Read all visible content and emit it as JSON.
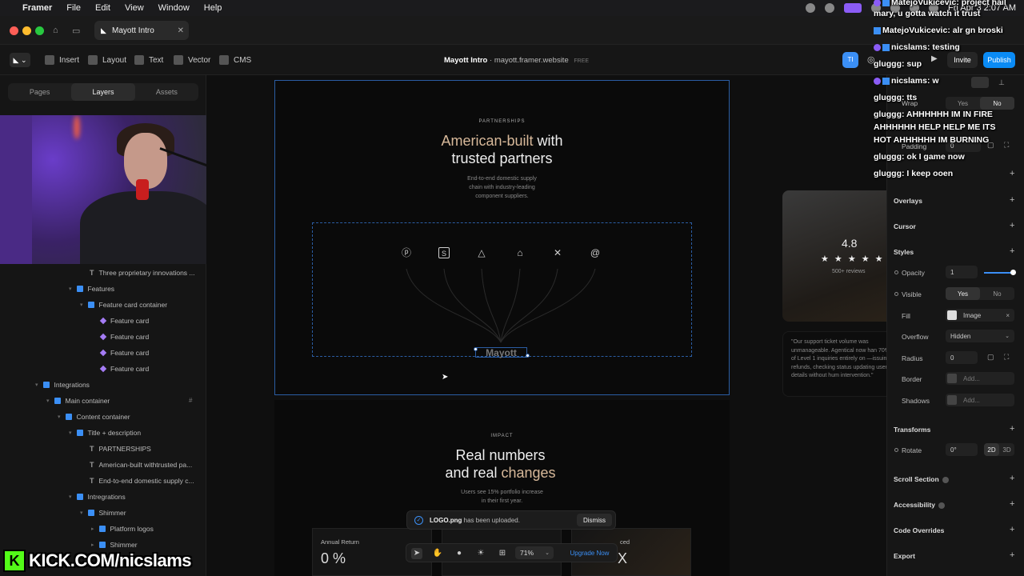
{
  "menubar": {
    "app": "Framer",
    "items": [
      "File",
      "Edit",
      "View",
      "Window",
      "Help"
    ],
    "clock": "Fri Apr 3  2:07 AM"
  },
  "titlebar": {
    "tab_title": "Mayott Intro"
  },
  "toolbar": {
    "tools": [
      "Insert",
      "Layout",
      "Text",
      "Vector",
      "CMS"
    ],
    "site_name": "Mayott Intro",
    "site_url": "mayott.framer.website",
    "plan": "FREE",
    "avatar_initials": "TI",
    "invite_label": "Invite",
    "publish_label": "Publish"
  },
  "left_panel": {
    "tabs": [
      "Pages",
      "Layers",
      "Assets"
    ],
    "active_tab": "Layers",
    "layers": [
      {
        "type": "text",
        "label": "Three proprietary innovations ..."
      },
      {
        "type": "frame",
        "label": "Features"
      },
      {
        "type": "frame",
        "label": "Feature card container"
      },
      {
        "type": "component",
        "label": "Feature card"
      },
      {
        "type": "component",
        "label": "Feature card"
      },
      {
        "type": "component",
        "label": "Feature card"
      },
      {
        "type": "component",
        "label": "Feature card"
      },
      {
        "type": "frame",
        "label": "Integrations"
      },
      {
        "type": "frame",
        "label": "Main container"
      },
      {
        "type": "frame",
        "label": "Content container"
      },
      {
        "type": "frame",
        "label": "Title + description"
      },
      {
        "type": "text",
        "label": "PARTNERSHIPS"
      },
      {
        "type": "text",
        "label": "American-built withtrusted pa..."
      },
      {
        "type": "text",
        "label": "End-to-end domestic supply c..."
      },
      {
        "type": "frame",
        "label": "Intregrations"
      },
      {
        "type": "frame",
        "label": "Shimmer"
      },
      {
        "type": "frame",
        "label": "Platform logos"
      },
      {
        "type": "frame",
        "label": "Shimmer"
      }
    ]
  },
  "canvas": {
    "section1": {
      "eyebrow": "PARTNERSHIPS",
      "heading_accent": "American-built",
      "heading_rest_1": " with",
      "heading_line2": "trusted partners",
      "subtitle_1": "End-to-end domestic supply",
      "subtitle_2": "chain with industry-leading",
      "subtitle_3": "component suppliers.",
      "logo_icons": [
        "paypal-icon",
        "stripe-icon",
        "drive-icon",
        "bank-icon",
        "x-icon",
        "threads-icon"
      ],
      "center_logo": "Mayott"
    },
    "section2": {
      "eyebrow": "IMPACT",
      "heading_line1": "Real numbers",
      "heading_line2_pre": "and real ",
      "heading_line2_accent": "changes",
      "subtitle_1": "Users see 15% portfolio increase",
      "subtitle_2": "in their first year.",
      "stat1_label": "Annual Return",
      "stat1_value": "0 %",
      "stat3_label": "ced",
      "stat3_value": "X"
    },
    "review_card": {
      "rating": "4.8",
      "stars": "★ ★ ★ ★ ★",
      "reviews": "500+ reviews"
    },
    "quote_card": {
      "text": "\"Our support ticket volume was unmanageable. Agentical now han 70% of Level 1 inquiries entirely on —issuing refunds, checking status updating user details without hum intervention.\""
    }
  },
  "right_panel": {
    "wrap_label": "Wrap",
    "wrap_yes": "Yes",
    "wrap_no": "No",
    "padding_label": "Padding",
    "padding_value": "0",
    "overlays": "Overlays",
    "cursor": "Cursor",
    "styles": "Styles",
    "opacity_label": "Opacity",
    "opacity_value": "1",
    "visible_label": "Visible",
    "visible_yes": "Yes",
    "visible_no": "No",
    "fill_label": "Fill",
    "fill_value": "Image",
    "overflow_label": "Overflow",
    "overflow_value": "Hidden",
    "radius_label": "Radius",
    "radius_value": "0",
    "border_label": "Border",
    "border_value": "Add...",
    "shadows_label": "Shadows",
    "shadows_value": "Add...",
    "transforms": "Transforms",
    "rotate_label": "Rotate",
    "rotate_value": "0°",
    "mode_2d": "2D",
    "mode_3d": "3D",
    "scroll_section": "Scroll Section",
    "accessibility": "Accessibility",
    "code_overrides": "Code Overrides",
    "export": "Export"
  },
  "chat": [
    {
      "user": "MatejoVukicevic:",
      "msg": " project hail"
    },
    {
      "user": "",
      "msg": "mary, u gotta watch it trust"
    },
    {
      "user": "MatejoVukicevic:",
      "msg": " alr gn broski"
    },
    {
      "user": "nicslams:",
      "msg": " testing"
    },
    {
      "user": "gluggg:",
      "msg": " sup"
    },
    {
      "user": "nicslams:",
      "msg": " w"
    },
    {
      "user": "gluggg:",
      "msg": " tts"
    },
    {
      "user": "gluggg:",
      "msg": " AHHHHHH IM IN FIRE"
    },
    {
      "user": "",
      "msg": "AHHHHHH HELP HELP ME ITS"
    },
    {
      "user": "",
      "msg": "HOT AHHHHHH IM BURNING"
    },
    {
      "user": "gluggg:",
      "msg": " ok I game now"
    },
    {
      "user": "gluggg:",
      "msg": " I keep ooen"
    }
  ],
  "toast": {
    "filename": "LOGO.png",
    "message": " has been uploaded.",
    "dismiss": "Dismiss"
  },
  "bottom_bar": {
    "zoom": "71%",
    "upgrade": "Upgrade Now"
  },
  "stream_banner": {
    "text": "KICK.COM/nicslams",
    "logo_letter": "K"
  },
  "colors": {
    "accent_blue": "#3b8ff5",
    "heading_accent": "#d8b99a",
    "kick_green": "#53fc18"
  }
}
